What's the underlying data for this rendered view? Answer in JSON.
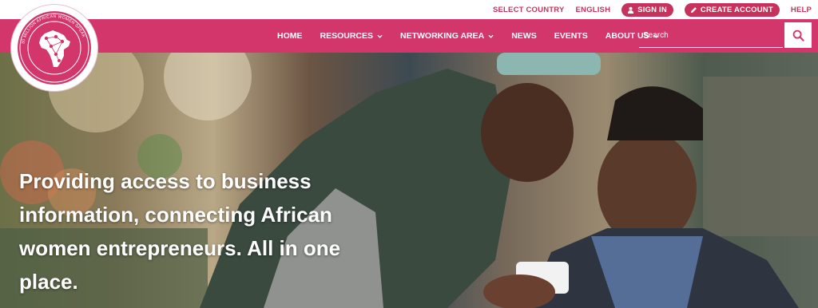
{
  "topbar": {
    "select_country": "SELECT COUNTRY",
    "language": "ENGLISH",
    "sign_in": "SIGN IN",
    "create_account": "CREATE ACCOUNT",
    "help": "HELP"
  },
  "logo": {
    "ring_text": "30 MILLION AFRICAN WOMEN SPEAK"
  },
  "nav": {
    "items": [
      {
        "label": "HOME",
        "dropdown": false
      },
      {
        "label": "RESOURCES",
        "dropdown": true
      },
      {
        "label": "NETWORKING AREA",
        "dropdown": true
      },
      {
        "label": "NEWS",
        "dropdown": false
      },
      {
        "label": "EVENTS",
        "dropdown": false
      },
      {
        "label": "ABOUT US",
        "dropdown": true
      }
    ],
    "search_placeholder": "Search"
  },
  "hero": {
    "headline": "Providing access to business information, connecting African women entrepreneurs. All in one place."
  },
  "colors": {
    "brand": "#d3366a",
    "topbar_text": "#c7325c"
  },
  "icons": {
    "sign_in": "user-icon",
    "create_account": "pencil-icon",
    "search": "search-icon",
    "dropdown": "chevron-down-icon"
  }
}
